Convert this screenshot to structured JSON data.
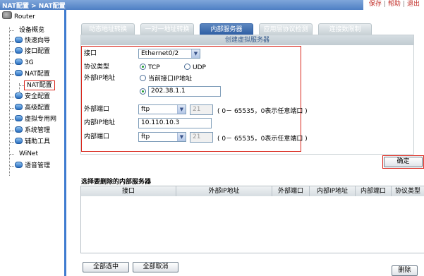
{
  "header": {
    "breadcrumb": "NAT配置 > NAT配置",
    "links": [
      "保存",
      "帮助",
      "退出"
    ]
  },
  "sidebar": {
    "root": "Router",
    "items": [
      {
        "label": "设备概览",
        "icon": "none"
      },
      {
        "label": "快速向导",
        "icon": "folder-icon"
      },
      {
        "label": "接口配置",
        "icon": "folder-icon"
      },
      {
        "label": "3G",
        "icon": "folder-icon"
      },
      {
        "label": "NAT配置",
        "icon": "folder-icon"
      },
      {
        "label": "NAT配置",
        "icon": "none",
        "selected": true
      },
      {
        "label": "安全配置",
        "icon": "folder-icon"
      },
      {
        "label": "高级配置",
        "icon": "folder-icon"
      },
      {
        "label": "虚拟专用网",
        "icon": "folder-icon"
      },
      {
        "label": "系统管理",
        "icon": "folder-icon"
      },
      {
        "label": "辅助工具",
        "icon": "folder-icon"
      },
      {
        "label": "WiNet",
        "icon": "none"
      },
      {
        "label": "语音管理",
        "icon": "folder-icon"
      }
    ]
  },
  "tabs": [
    {
      "label": "动态地址转换",
      "active": false
    },
    {
      "label": "一对一地址转换",
      "active": false
    },
    {
      "label": "内部服务器",
      "active": true
    },
    {
      "label": "应用层协议检测",
      "active": false
    },
    {
      "label": "连接数限制",
      "active": false
    }
  ],
  "form": {
    "title": "创建虚拟服务器",
    "interface_label": "接口",
    "interface_value": "Ethernet0/2",
    "protocol_label": "协议类型",
    "protocol_tcp": "TCP",
    "protocol_udp": "UDP",
    "protocol_selected": "TCP",
    "ext_ip_label": "外部IP地址",
    "ext_ip_option_current": "当前接口IP地址",
    "ext_ip_value": "202.38.1.1",
    "ext_port_label": "外部端口",
    "ext_port_select": "ftp",
    "ext_port_number": "21",
    "port_hint": "( 0－ 65535，0表示任意端口 )",
    "int_ip_label": "内部IP地址",
    "int_ip_value": "10.110.10.3",
    "int_port_label": "内部端口",
    "int_port_select": "ftp",
    "int_port_number": "21",
    "confirm_button": "确定"
  },
  "delete_section": {
    "title": "选择要删除的内部服务器",
    "columns": [
      "接口",
      "外部IP地址",
      "外部端口",
      "内部IP地址",
      "内部端口",
      "协议类型"
    ],
    "rows": [],
    "select_all_button": "全部选中",
    "deselect_all_button": "全部取消",
    "delete_button": "删除"
  },
  "colors": {
    "topbar": "#4e7fc4",
    "sidebar_border": "#3f7bd0",
    "active_tab": "#2f5fa4",
    "highlight_red": "#d9261c"
  }
}
